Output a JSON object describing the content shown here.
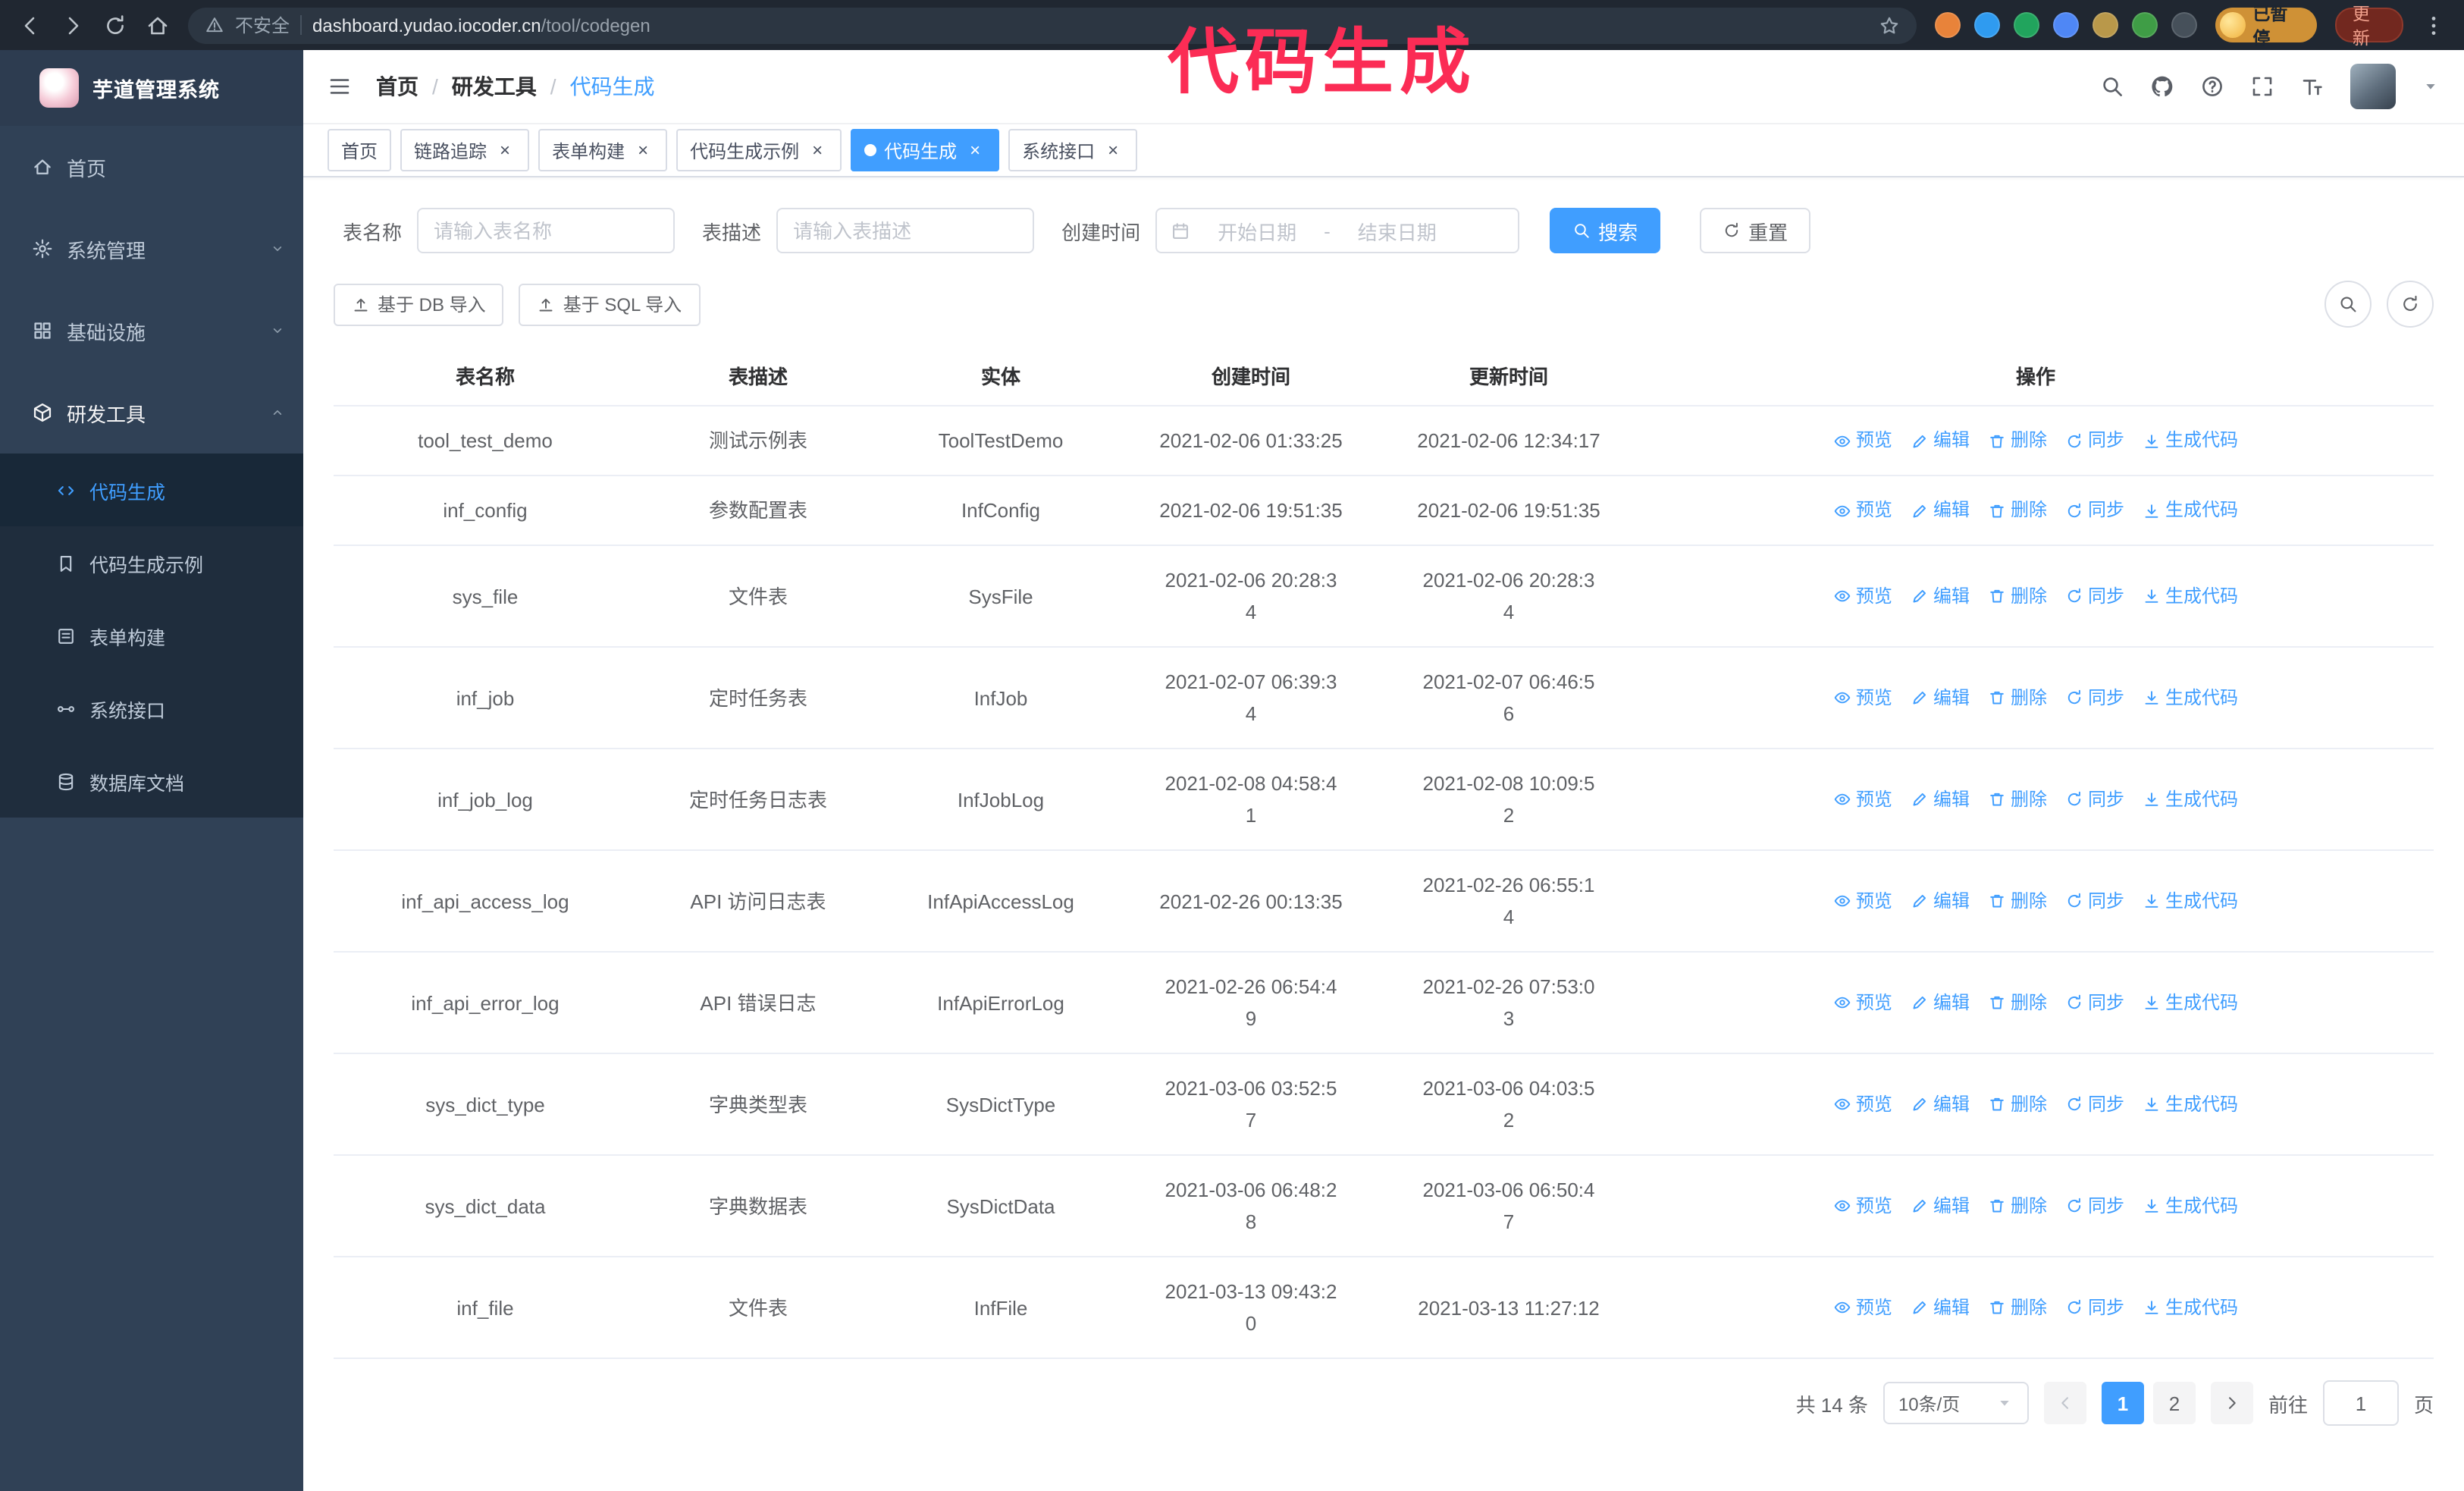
{
  "colors": {
    "accent": "#409eff",
    "annotation": "#fb2c55"
  },
  "annotation": {
    "text": "代码生成",
    "color": "#fb2c55"
  },
  "browser": {
    "security_label": "不安全",
    "url_host": "dashboard.yudao.iocoder.cn",
    "url_path": "/tool/codegen",
    "profile_label": "已暂停",
    "update_label": "更新",
    "extensions": [
      {
        "name": "fox-extension-icon",
        "color": "#e8833a"
      },
      {
        "name": "drop-extension-icon",
        "color": "#2f9bf0"
      },
      {
        "name": "check-extension-icon",
        "color": "#21a45d"
      },
      {
        "name": "people-extension-icon",
        "color": "#4f87f5"
      },
      {
        "name": "card-extension-icon",
        "color": "#b9984a"
      },
      {
        "name": "leaf-extension-icon",
        "color": "#3f9d46"
      },
      {
        "name": "pin-extension-icon",
        "color": "#46505a"
      }
    ]
  },
  "sidebar": {
    "title": "芋道管理系统",
    "items": [
      {
        "key": "home",
        "label": "首页",
        "icon": "home-icon"
      },
      {
        "key": "system",
        "label": "系统管理",
        "icon": "gear-icon",
        "chevron": "down"
      },
      {
        "key": "infra",
        "label": "基础设施",
        "icon": "infra-icon",
        "chevron": "down"
      },
      {
        "key": "devtools",
        "label": "研发工具",
        "icon": "devtools-icon",
        "chevron": "up",
        "active": true
      }
    ],
    "subitems": [
      {
        "key": "codegen",
        "label": "代码生成",
        "icon": "codegen-icon",
        "active": true
      },
      {
        "key": "codegen-example",
        "label": "代码生成示例",
        "icon": "example-icon"
      },
      {
        "key": "form-builder",
        "label": "表单构建",
        "icon": "form-icon"
      },
      {
        "key": "system-api",
        "label": "系统接口",
        "icon": "api-icon"
      },
      {
        "key": "db-doc",
        "label": "数据库文档",
        "icon": "db-icon"
      }
    ]
  },
  "header": {
    "breadcrumb": [
      "首页",
      "研发工具",
      "代码生成"
    ]
  },
  "tabs": [
    {
      "key": "home",
      "label": "首页",
      "closable": false
    },
    {
      "key": "trace",
      "label": "链路追踪",
      "closable": true
    },
    {
      "key": "form-builder",
      "label": "表单构建",
      "closable": true
    },
    {
      "key": "codegen-example",
      "label": "代码生成示例",
      "closable": true
    },
    {
      "key": "codegen",
      "label": "代码生成",
      "closable": true,
      "active": true
    },
    {
      "key": "system-api",
      "label": "系统接口",
      "closable": true
    }
  ],
  "search": {
    "name_label": "表名称",
    "name_placeholder": "请输入表名称",
    "desc_label": "表描述",
    "desc_placeholder": "请输入表描述",
    "time_label": "创建时间",
    "start_placeholder": "开始日期",
    "range_separator": "-",
    "end_placeholder": "结束日期",
    "search_btn": "搜索",
    "reset_btn": "重置"
  },
  "toolbar": {
    "import_db": "基于 DB 导入",
    "import_sql": "基于 SQL 导入"
  },
  "table": {
    "columns": [
      "表名称",
      "表描述",
      "实体",
      "创建时间",
      "更新时间",
      "操作"
    ],
    "op_labels": [
      "预览",
      "编辑",
      "删除",
      "同步",
      "生成代码"
    ],
    "rows": [
      {
        "name": "tool_test_demo",
        "desc": "测试示例表",
        "entity": "ToolTestDemo",
        "created": "2021-02-06 01:33:25",
        "updated": "2021-02-06 12:34:17"
      },
      {
        "name": "inf_config",
        "desc": "参数配置表",
        "entity": "InfConfig",
        "created": "2021-02-06 19:51:35",
        "updated": "2021-02-06 19:51:35"
      },
      {
        "name": "sys_file",
        "desc": "文件表",
        "entity": "SysFile",
        "created": "2021-02-06 20:28:3\n4",
        "updated": "2021-02-06 20:28:3\n4"
      },
      {
        "name": "inf_job",
        "desc": "定时任务表",
        "entity": "InfJob",
        "created": "2021-02-07 06:39:3\n4",
        "updated": "2021-02-07 06:46:5\n6"
      },
      {
        "name": "inf_job_log",
        "desc": "定时任务日志表",
        "entity": "InfJobLog",
        "created": "2021-02-08 04:58:4\n1",
        "updated": "2021-02-08 10:09:5\n2"
      },
      {
        "name": "inf_api_access_log",
        "desc": "API 访问日志表",
        "entity": "InfApiAccessLog",
        "created": "2021-02-26 00:13:35",
        "updated": "2021-02-26 06:55:1\n4"
      },
      {
        "name": "inf_api_error_log",
        "desc": "API 错误日志",
        "entity": "InfApiErrorLog",
        "created": "2021-02-26 06:54:4\n9",
        "updated": "2021-02-26 07:53:0\n3"
      },
      {
        "name": "sys_dict_type",
        "desc": "字典类型表",
        "entity": "SysDictType",
        "created": "2021-03-06 03:52:5\n7",
        "updated": "2021-03-06 04:03:5\n2"
      },
      {
        "name": "sys_dict_data",
        "desc": "字典数据表",
        "entity": "SysDictData",
        "created": "2021-03-06 06:48:2\n8",
        "updated": "2021-03-06 06:50:4\n7"
      },
      {
        "name": "inf_file",
        "desc": "文件表",
        "entity": "InfFile",
        "created": "2021-03-13 09:43:2\n0",
        "updated": "2021-03-13 11:27:12"
      }
    ]
  },
  "pagination": {
    "total_text": "共 14 条",
    "page_size": "10条/页",
    "pages": [
      "1",
      "2"
    ],
    "active_page": "1",
    "goto_label": "前往",
    "goto_value": "1",
    "goto_suffix": "页"
  }
}
